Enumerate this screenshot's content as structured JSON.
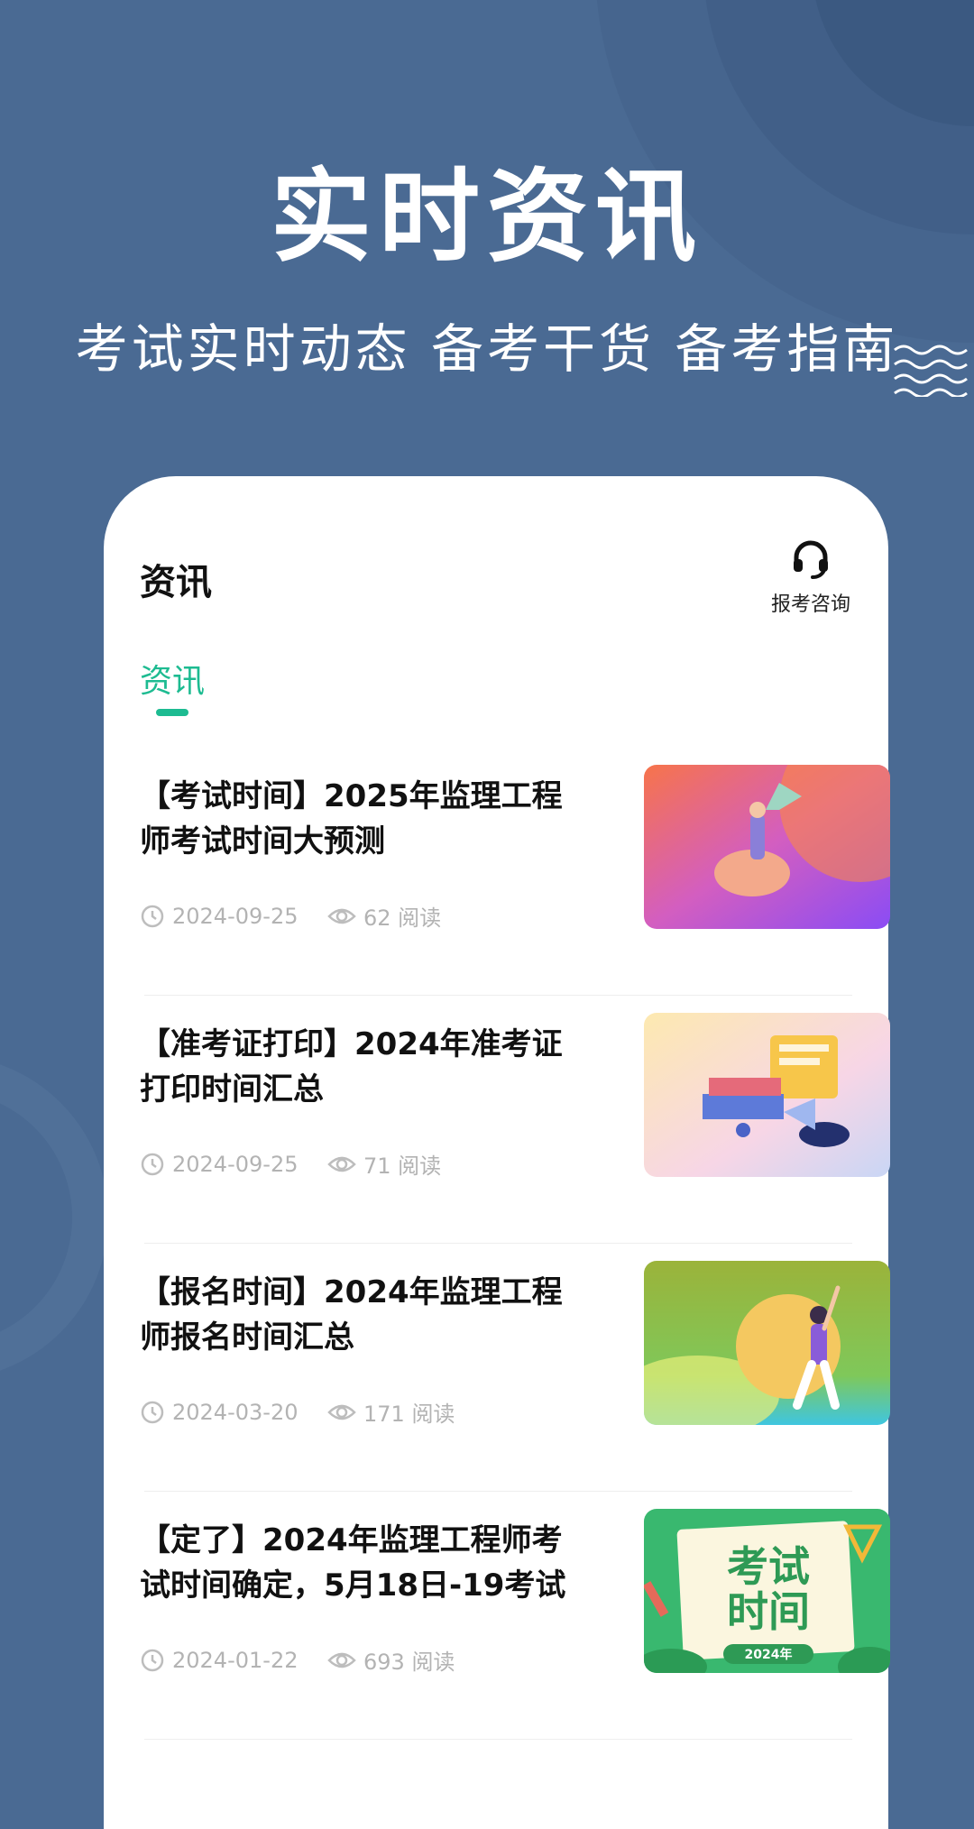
{
  "hero": {
    "title": "实时资讯",
    "subtitle": "考试实时动态  备考干货  备考指南"
  },
  "card": {
    "title": "资讯",
    "consult_label": "报考咨询"
  },
  "tabs": [
    {
      "label": "资讯",
      "active": true
    }
  ],
  "articles": [
    {
      "title": "【考试时间】2025年监理工程师考试时间大预测",
      "date": "2024-09-25",
      "views": "62 阅读"
    },
    {
      "title": "【准考证打印】2024年准考证打印时间汇总",
      "date": "2024-09-25",
      "views": "71 阅读"
    },
    {
      "title": "【报名时间】2024年监理工程师报名时间汇总",
      "date": "2024-03-20",
      "views": "171 阅读"
    },
    {
      "title": "【定了】2024年监理工程师考试时间确定，5月18日-19考试",
      "date": "2024-01-22",
      "views": "693 阅读",
      "thumb_text_1": "考试",
      "thumb_text_2": "时间",
      "thumb_badge": "2024年"
    }
  ],
  "colors": {
    "background": "#4a6a93",
    "accent": "#1dbb91"
  }
}
